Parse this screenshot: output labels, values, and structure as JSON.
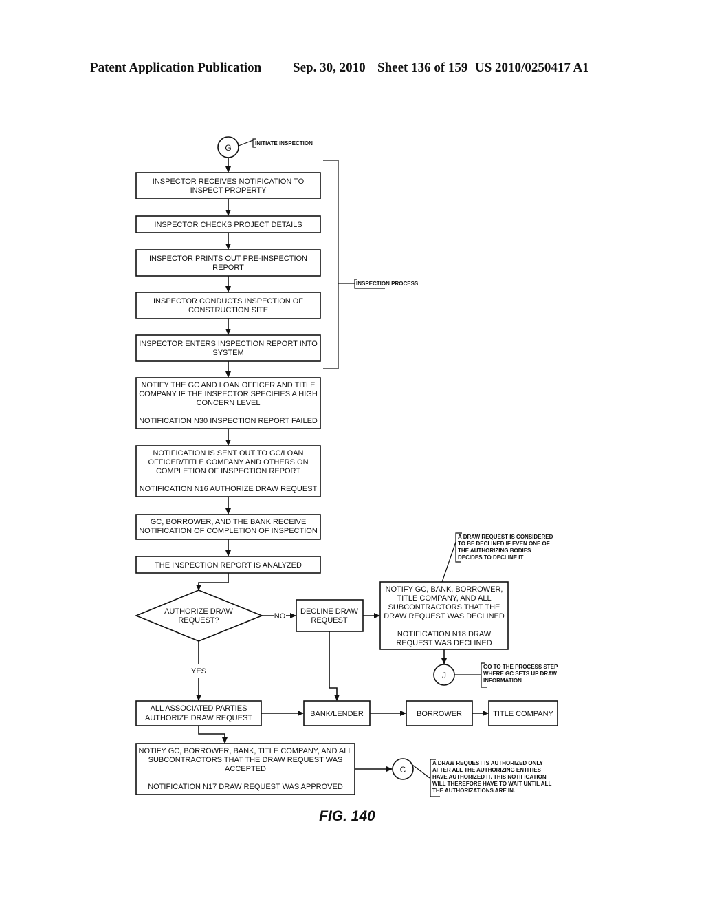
{
  "header": {
    "publication": "Patent Application Publication",
    "date": "Sep. 30, 2010",
    "sheet": "Sheet 136 of 159",
    "number": "US 2010/0250417 A1"
  },
  "connectors": {
    "start": "G",
    "decline_end": "J",
    "accept_end": "C"
  },
  "annotations": {
    "initiate": "INITIATE INSPECTION",
    "inspection_process": "INSPECTION PROCESS",
    "declined_note": [
      "A DRAW REQUEST IS CONSIDERED",
      "TO BE DECLINED IF EVEN ONE OF",
      "THE AUTHORIZING BODIES",
      "DECIDES TO DECLINE IT"
    ],
    "goto_note": [
      "GO TO THE PROCESS STEP",
      "WHERE GC SETS UP DRAW",
      "INFORMATION"
    ],
    "authorized_note": [
      "A DRAW REQUEST IS AUTHORIZED ONLY",
      "AFTER ALL THE AUTHORIZING ENTITIES",
      "HAVE AUTHORIZED IT.  THIS NOTIFICATION",
      "WILL THEREFORE HAVE TO WAIT UNTIL ALL",
      "THE AUTHORIZATIONS ARE IN."
    ]
  },
  "steps": {
    "receive": [
      "INSPECTOR RECEIVES NOTIFICATION TO",
      "INSPECT PROPERTY"
    ],
    "checks": [
      "INSPECTOR CHECKS PROJECT DETAILS"
    ],
    "prints": [
      "INSPECTOR PRINTS OUT PRE-INSPECTION",
      "REPORT"
    ],
    "conducts": [
      "INSPECTOR CONDUCTS INSPECTION OF",
      "CONSTRUCTION SITE"
    ],
    "enters": [
      "INSPECTOR ENTERS INSPECTION REPORT INTO",
      "SYSTEM"
    ],
    "notify_high": [
      "NOTIFY THE GC AND LOAN OFFICER AND TITLE",
      "COMPANY IF THE INSPECTOR SPECIFIES A HIGH",
      "CONCERN LEVEL",
      "",
      "NOTIFICATION N30 INSPECTION REPORT FAILED"
    ],
    "notify_sent": [
      "NOTIFICATION IS SENT OUT TO GC/LOAN",
      "OFFICER/TITLE COMPANY AND OTHERS ON",
      "COMPLETION OF INSPECTION REPORT",
      "",
      "NOTIFICATION N16 AUTHORIZE DRAW REQUEST"
    ],
    "receive_notif": [
      "GC, BORROWER, AND THE BANK RECEIVE",
      "NOTIFICATION OF COMPLETION OF INSPECTION"
    ],
    "analyzed": [
      "THE INSPECTION REPORT IS ANALYZED"
    ],
    "decision": [
      "AUTHORIZE DRAW",
      "REQUEST?"
    ],
    "decline": [
      "DECLINE DRAW",
      "REQUEST"
    ],
    "notify_declined": [
      "NOTIFY GC, BANK, BORROWER,",
      "TITLE COMPANY, AND ALL",
      "SUBCONTRACTORS THAT THE",
      "DRAW REQUEST WAS DECLINED",
      "",
      "NOTIFICATION N18 DRAW",
      "REQUEST WAS DECLINED"
    ],
    "all_parties": [
      "ALL ASSOCIATED PARTIES",
      "AUTHORIZE DRAW REQUEST"
    ],
    "bank": [
      "BANK/LENDER"
    ],
    "borrower": [
      "BORROWER"
    ],
    "title": [
      "TITLE COMPANY"
    ],
    "notify_accepted": [
      "NOTIFY GC, BORROWER, BANK, TITLE COMPANY, AND ALL",
      "SUBCONTRACTORS THAT THE DRAW REQUEST WAS",
      "ACCEPTED",
      "",
      "NOTIFICATION N17 DRAW REQUEST WAS APPROVED"
    ]
  },
  "labels": {
    "no": "NO",
    "yes": "YES"
  },
  "figure": "FIG. 140"
}
